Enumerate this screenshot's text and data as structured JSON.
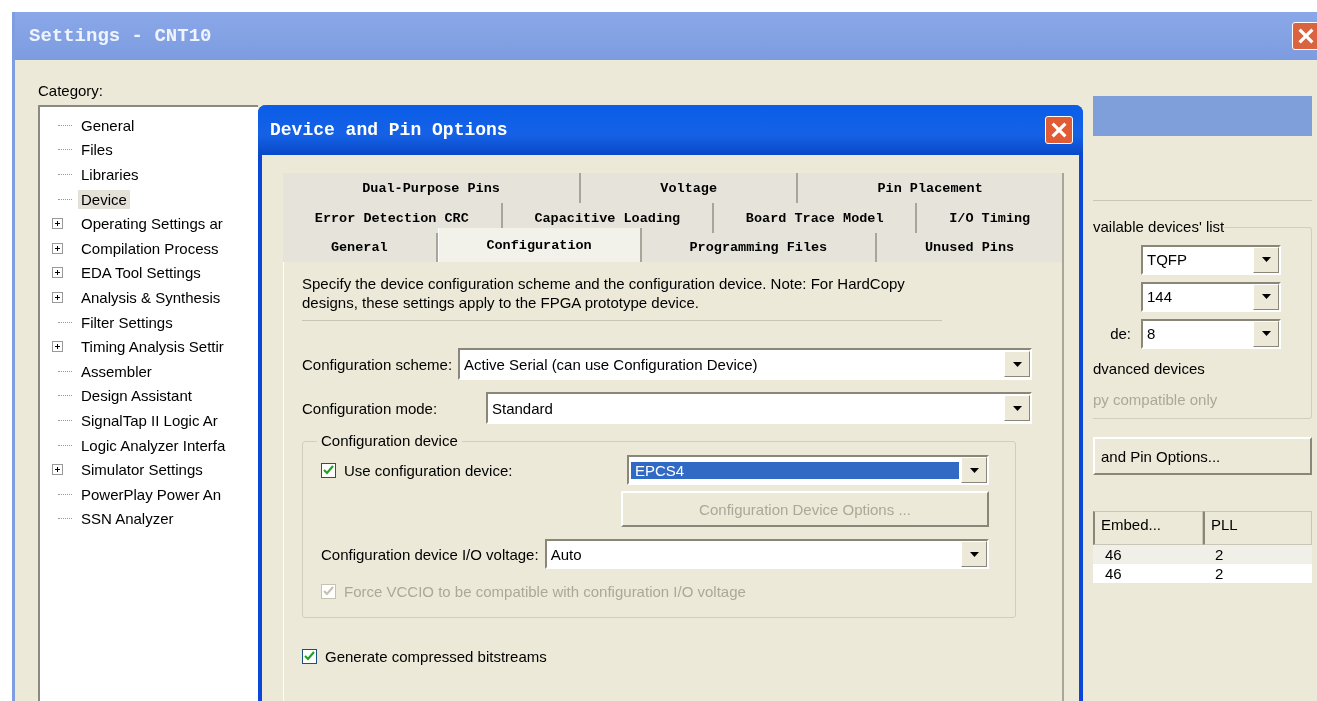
{
  "settings_window": {
    "title": "Settings - CNT10",
    "category_label": "Category:",
    "tree": [
      {
        "label": "General",
        "expandable": false,
        "selected": false
      },
      {
        "label": "Files",
        "expandable": false,
        "selected": false
      },
      {
        "label": "Libraries",
        "expandable": false,
        "selected": false
      },
      {
        "label": "Device",
        "expandable": false,
        "selected": true
      },
      {
        "label": "Operating Settings ar",
        "expandable": true,
        "selected": false
      },
      {
        "label": "Compilation Process",
        "expandable": true,
        "selected": false
      },
      {
        "label": "EDA Tool Settings",
        "expandable": true,
        "selected": false
      },
      {
        "label": "Analysis & Synthesis",
        "expandable": true,
        "selected": false
      },
      {
        "label": "Filter Settings",
        "expandable": false,
        "selected": false
      },
      {
        "label": "Timing Analysis Settir",
        "expandable": true,
        "selected": false
      },
      {
        "label": "Assembler",
        "expandable": false,
        "selected": false
      },
      {
        "label": "Design Assistant",
        "expandable": false,
        "selected": false
      },
      {
        "label": "SignalTap II Logic Ar",
        "expandable": false,
        "selected": false
      },
      {
        "label": "Logic Analyzer Interfa",
        "expandable": false,
        "selected": false
      },
      {
        "label": "Simulator Settings",
        "expandable": true,
        "selected": false
      },
      {
        "label": "PowerPlay Power An",
        "expandable": false,
        "selected": false
      },
      {
        "label": "SSN Analyzer",
        "expandable": false,
        "selected": false
      }
    ],
    "right_panel": {
      "group_title": "vailable devices' list",
      "combos": [
        {
          "value": "TQFP"
        },
        {
          "value": "144"
        },
        {
          "label": "de:",
          "value": "8"
        }
      ],
      "checkbox_text": "dvanced devices",
      "disabled_text": "py compatible only",
      "button": "and Pin Options...",
      "table": {
        "columns": [
          "Embed...",
          "PLL"
        ],
        "rows": [
          [
            "46",
            "2"
          ],
          [
            "46",
            "2"
          ]
        ]
      }
    }
  },
  "dialog": {
    "title": "Device and Pin Options",
    "tab_rows": [
      [
        {
          "label": "Dual-Purpose Pins",
          "selected": false
        },
        {
          "label": "Voltage",
          "selected": false
        },
        {
          "label": "Pin Placement",
          "selected": false
        }
      ],
      [
        {
          "label": "Error Detection CRC",
          "selected": false
        },
        {
          "label": "Capacitive Loading",
          "selected": false
        },
        {
          "label": "Board Trace Model",
          "selected": false
        },
        {
          "label": "I/O Timing",
          "selected": false
        }
      ],
      [
        {
          "label": "General",
          "selected": false
        },
        {
          "label": "Configuration",
          "selected": true
        },
        {
          "label": "Programming Files",
          "selected": false
        },
        {
          "label": "Unused Pins",
          "selected": false
        }
      ]
    ],
    "description": "Specify the device configuration scheme and the configuration device. Note: For HardCopy designs, these settings apply to the FPGA prototype device.",
    "scheme": {
      "label": "Configuration scheme:",
      "value": "Active Serial (can use Configuration Device)"
    },
    "mode": {
      "label": "Configuration mode:",
      "value": "Standard"
    },
    "device_group": {
      "title": "Configuration device",
      "use_device": {
        "label": "Use configuration device:",
        "checked": true,
        "disabled": false
      },
      "device": {
        "value": "EPCS4",
        "highlighted": true
      },
      "options_button": {
        "label": "Configuration Device Options ...",
        "disabled": true
      },
      "voltage": {
        "label": "Configuration device I/O voltage:",
        "value": "Auto"
      },
      "force_vccio": {
        "label": "Force VCCIO to be compatible with configuration I/O voltage",
        "checked": true,
        "disabled": true
      }
    },
    "compressed": {
      "label": "Generate compressed bitstreams",
      "checked": true,
      "disabled": false
    }
  }
}
